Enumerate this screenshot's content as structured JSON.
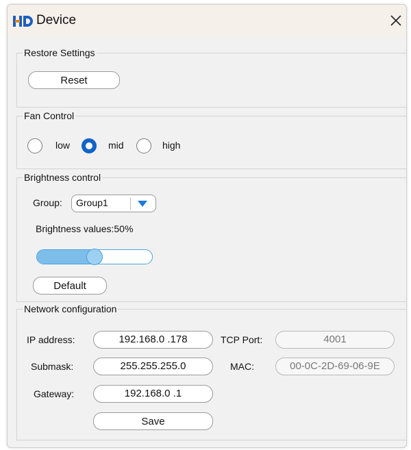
{
  "window": {
    "title": "Device",
    "logo_text": "HD",
    "close_icon": "close-icon"
  },
  "restore": {
    "legend": "Restore Settings",
    "reset_label": "Reset"
  },
  "fan": {
    "legend": "Fan Control",
    "options": [
      {
        "label": "low",
        "selected": false
      },
      {
        "label": "mid",
        "selected": true
      },
      {
        "label": "high",
        "selected": false
      }
    ]
  },
  "brightness": {
    "legend": "Brightness control",
    "group_label": "Group:",
    "group_value": "Group1",
    "values_text": "Brightness values:50%",
    "level": 0.5,
    "default_label": "Default"
  },
  "network": {
    "legend": "Network configuration",
    "ip_label": "IP address:",
    "ip_value": "192.168.0  .178",
    "tcp_label": "TCP Port:",
    "tcp_value": "4001",
    "submask_label": "Submask:",
    "submask_value": "255.255.255.0",
    "mac_label": "MAC:",
    "mac_value": "00-0C-2D-69-06-9E",
    "gateway_label": "Gateway:",
    "gateway_value": "192.168.0  .1",
    "save_label": "Save"
  },
  "colors": {
    "accent": "#1264c8",
    "slider_fill": "#7cbdea",
    "slider_border": "#4ba3e0",
    "titlebar": "#f6f0eb"
  }
}
